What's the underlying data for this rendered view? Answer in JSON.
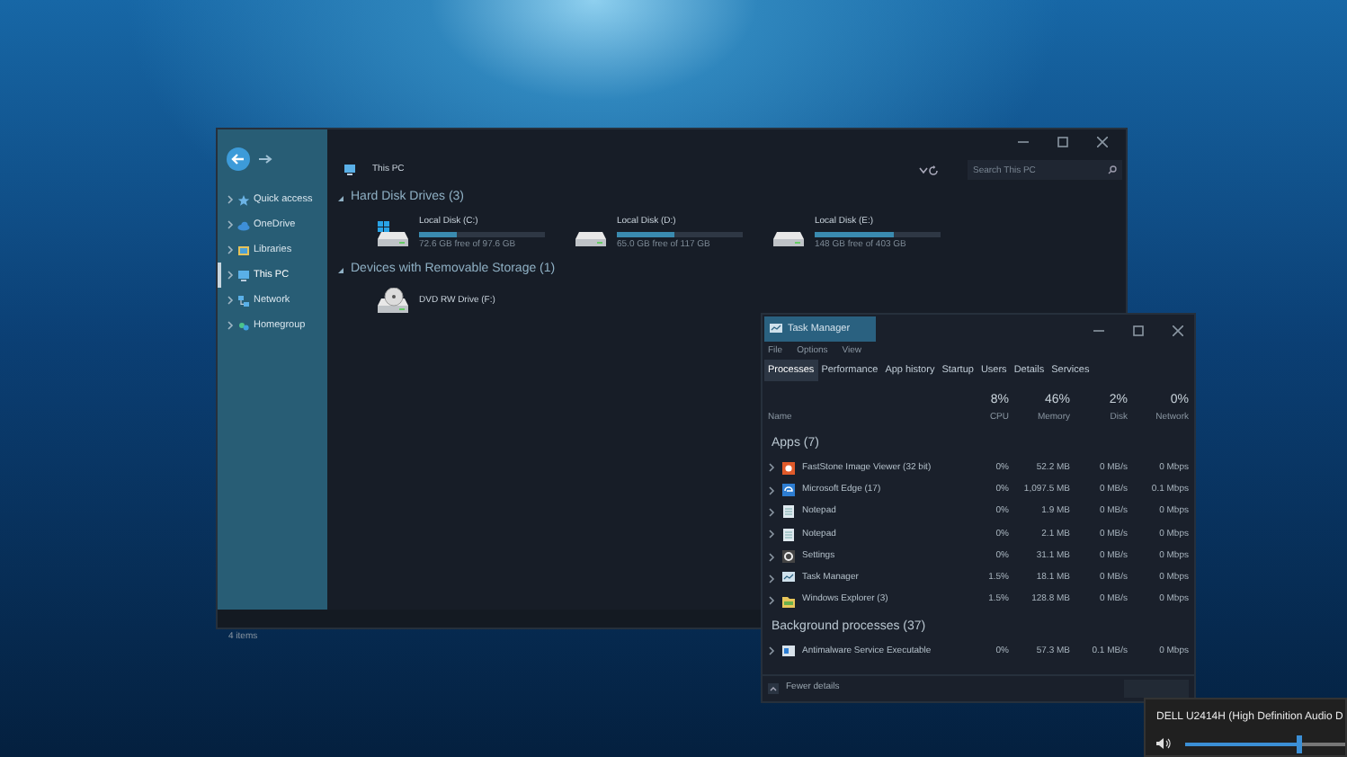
{
  "explorer": {
    "breadcrumb": "This PC",
    "search": {
      "placeholder": "Search This PC"
    },
    "sidebar": {
      "items": [
        {
          "label": "Quick access",
          "kind": "star",
          "selected": false
        },
        {
          "label": "OneDrive",
          "kind": "cloud",
          "selected": false
        },
        {
          "label": "Libraries",
          "kind": "library",
          "selected": false
        },
        {
          "label": "This PC",
          "kind": "pc",
          "selected": true
        },
        {
          "label": "Network",
          "kind": "network",
          "selected": false
        },
        {
          "label": "Homegroup",
          "kind": "homegroup",
          "selected": false
        }
      ]
    },
    "groups": [
      {
        "title": "Hard Disk Drives (3)",
        "drives": [
          {
            "kind": "system",
            "name": "Local Disk (C:)",
            "free": "72.6 GB free of 97.6 GB",
            "level": 0.3
          },
          {
            "kind": "disk",
            "name": "Local Disk (D:)",
            "free": "65.0 GB free of 117 GB",
            "level": 0.45
          },
          {
            "kind": "disk",
            "name": "Local Disk (E:)",
            "free": "148 GB free of 403 GB",
            "level": 0.63
          }
        ]
      },
      {
        "title": "Devices with Removable Storage (1)",
        "drives": [
          {
            "kind": "dvd",
            "name": "DVD RW Drive (F:)"
          }
        ]
      }
    ],
    "status_bar": "4 items"
  },
  "task_manager": {
    "title": "Task Manager",
    "menu": [
      "File",
      "Options",
      "View"
    ],
    "tabs": [
      {
        "label": "Processes",
        "selected": true
      },
      {
        "label": "Performance",
        "selected": false
      },
      {
        "label": "App history",
        "selected": false
      },
      {
        "label": "Startup",
        "selected": false
      },
      {
        "label": "Users",
        "selected": false
      },
      {
        "label": "Details",
        "selected": false
      },
      {
        "label": "Services",
        "selected": false
      }
    ],
    "columns": [
      {
        "label": "Name"
      },
      {
        "percent": "8%",
        "label": "CPU"
      },
      {
        "percent": "46%",
        "label": "Memory"
      },
      {
        "percent": "2%",
        "label": "Disk"
      },
      {
        "percent": "0%",
        "label": "Network"
      }
    ],
    "groups": [
      {
        "title": "Apps (7)",
        "rows": [
          {
            "kind": "viewer",
            "name": "FastStone Image Viewer (32 bit)",
            "cpu": "0%",
            "memory": "52.2 MB",
            "disk": "0 MB/s",
            "network": "0 Mbps"
          },
          {
            "kind": "browser",
            "name": "Microsoft Edge (17)",
            "cpu": "0%",
            "memory": "1,097.5 MB",
            "disk": "0 MB/s",
            "network": "0.1 Mbps"
          },
          {
            "kind": "notepad",
            "name": "Notepad",
            "cpu": "0%",
            "memory": "1.9 MB",
            "disk": "0 MB/s",
            "network": "0 Mbps"
          },
          {
            "kind": "notepad",
            "name": "Notepad",
            "cpu": "0%",
            "memory": "2.1 MB",
            "disk": "0 MB/s",
            "network": "0 Mbps"
          },
          {
            "kind": "settings",
            "name": "Settings",
            "cpu": "0%",
            "memory": "31.1 MB",
            "disk": "0 MB/s",
            "network": "0 Mbps"
          },
          {
            "kind": "taskmgr",
            "name": "Task Manager",
            "cpu": "1.5%",
            "memory": "18.1 MB",
            "disk": "0 MB/s",
            "network": "0 Mbps"
          },
          {
            "kind": "folder",
            "name": "Windows Explorer (3)",
            "cpu": "1.5%",
            "memory": "128.8 MB",
            "disk": "0 MB/s",
            "network": "0 Mbps"
          }
        ]
      },
      {
        "title": "Background processes (37)",
        "rows": [
          {
            "kind": "service",
            "name": "Antimalware Service Executable",
            "cpu": "0%",
            "memory": "57.3 MB",
            "disk": "0.1 MB/s",
            "network": "0 Mbps"
          }
        ]
      }
    ],
    "footer": "Fewer details"
  },
  "volume_flyout": {
    "device": "DELL U2414H (High Definition Audio D",
    "level": 0.7
  }
}
